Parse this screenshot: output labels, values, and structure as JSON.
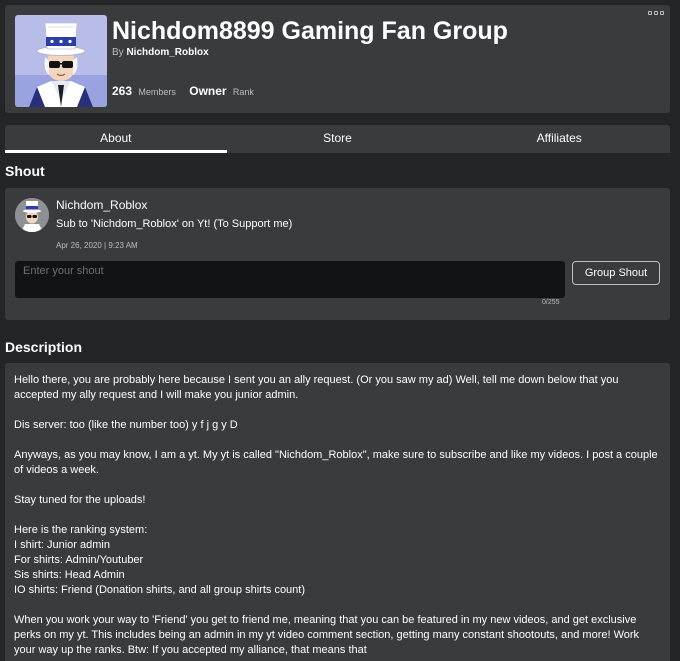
{
  "group": {
    "name": "Nichdom8899 Gaming Fan Group",
    "by_label": "By",
    "owner_name": "Nichdom_Roblox",
    "member_count": "263",
    "members_label": "Members",
    "rank_value": "Owner",
    "rank_label": "Rank"
  },
  "tabs": [
    {
      "label": "About",
      "active": true
    },
    {
      "label": "Store",
      "active": false
    },
    {
      "label": "Affiliates",
      "active": false
    }
  ],
  "shout": {
    "section_title": "Shout",
    "user": "Nichdom_Roblox",
    "message": "Sub to 'Nichdom_Roblox' on Yt! (To Support me)",
    "timestamp": "Apr 26, 2020 | 9:23 AM",
    "input_placeholder": "Enter your shout",
    "char_count": "0/255",
    "button_label": "Group Shout"
  },
  "description": {
    "section_title": "Description",
    "paragraphs": [
      [
        "Hello there, you are probably here because I sent you an ally request. (Or you saw my ad) Well, tell me down below that you accepted my ally request and I will make you junior admin."
      ],
      [
        "Dis server: too (like the number too) y f j g y D"
      ],
      [
        "Anyways, as you may know, I am a yt. My yt is called \"Nichdom_Roblox\", make sure to subscribe and like my videos. I post a couple of videos a week."
      ],
      [
        "Stay tuned for the uploads!"
      ],
      [
        "Here is the ranking system:",
        "I shirt: Junior admin",
        "For shirts: Admin/Youtuber",
        "Sis shirts: Head Admin",
        "IO shirts: Friend (Donation shirts, and all group shirts count)"
      ],
      [
        "When you work your way to 'Friend' you get to friend me, meaning that you can be featured in my new videos, and get exclusive perks on my yt. This includes being an admin in my yt video comment section, getting many constant shootouts, and more! Work your way up the ranks. Btw: If you accepted my alliance, that means that"
      ]
    ]
  },
  "icons": {
    "menu": "more-options-icon"
  },
  "colors": {
    "background": "#232527",
    "panel": "#393b3d",
    "input": "#121314",
    "muted_text": "#bdbebe"
  }
}
